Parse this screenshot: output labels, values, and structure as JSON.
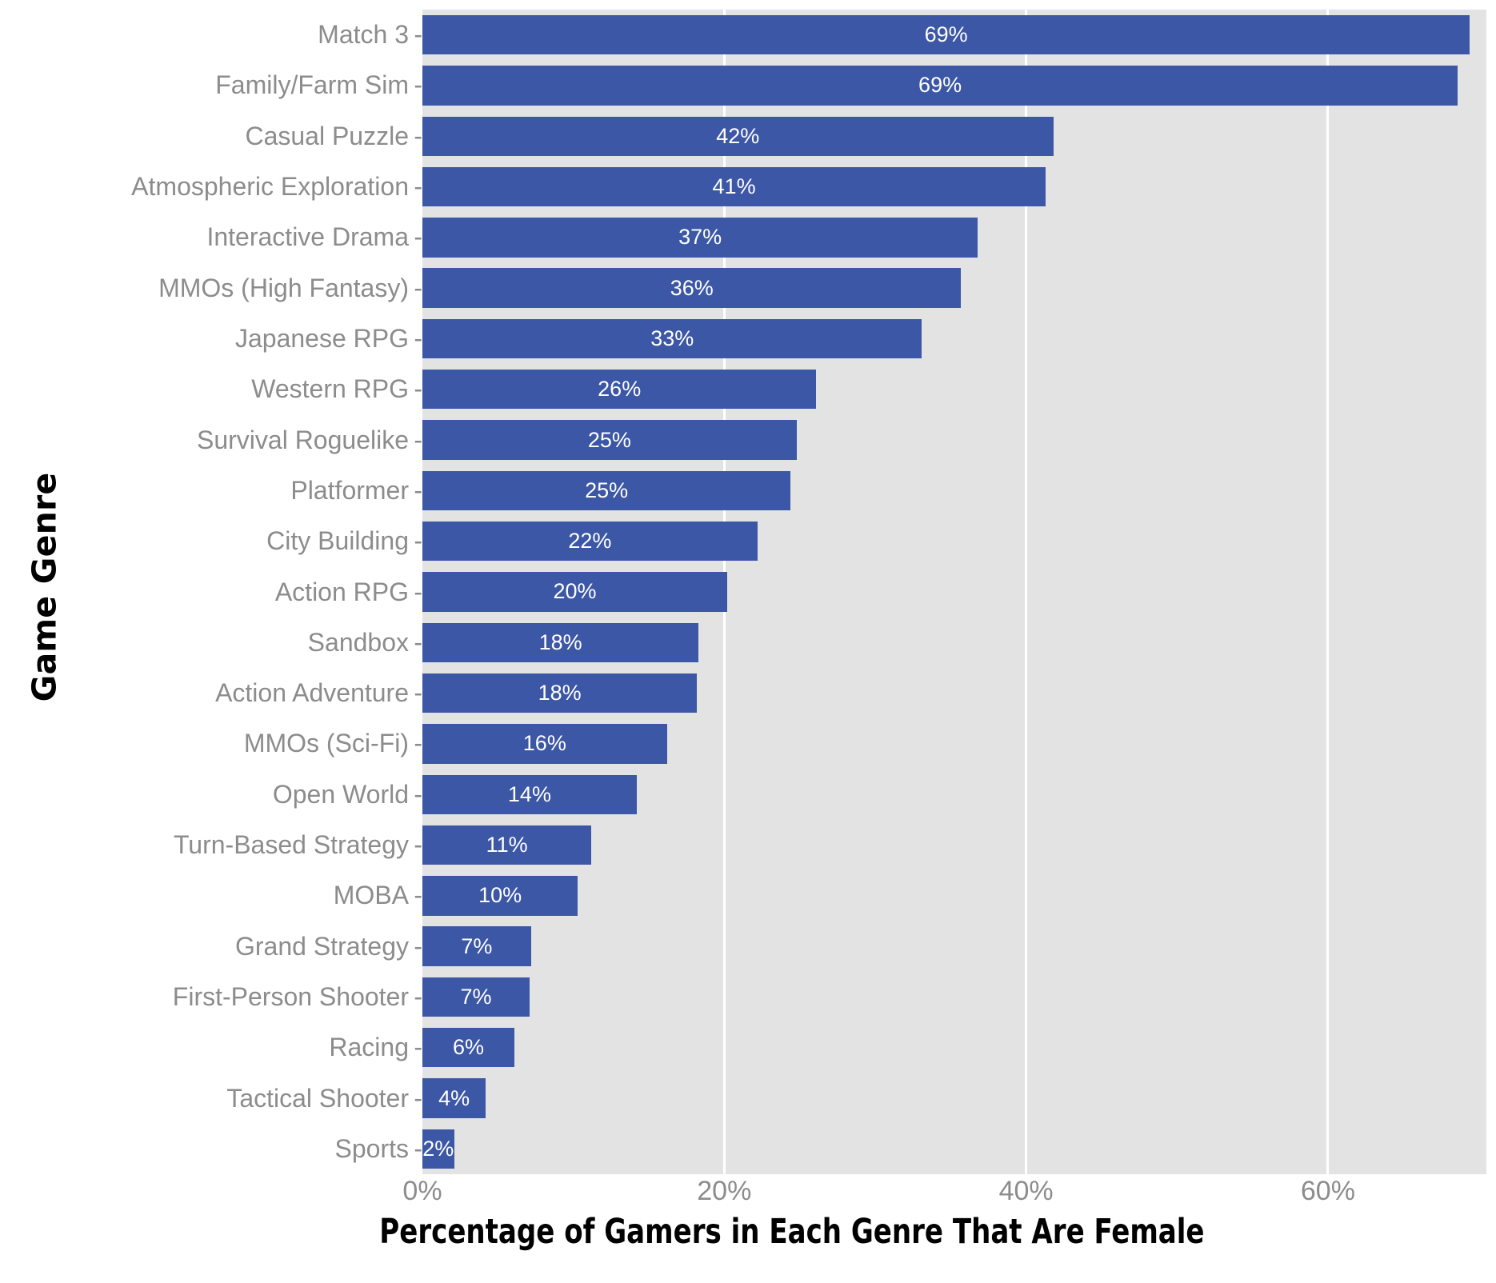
{
  "chart_data": {
    "type": "bar",
    "orientation": "horizontal",
    "title": "",
    "xlabel": "Percentage of Gamers in Each Genre That Are Female",
    "ylabel": "Game Genre",
    "xlim": [
      0,
      70.5
    ],
    "xticks": [
      0,
      20,
      40,
      60
    ],
    "xtick_labels": [
      "0%",
      "20%",
      "40%",
      "60%"
    ],
    "grid": "vertical-major-only",
    "legend": "none",
    "bar_color": "#3c57a6",
    "panel_color": "#e3e3e3",
    "gridline_color": "#ffffff",
    "tick_label_color": "#8c8c8c",
    "axis_title_color": "#000000",
    "value_label_color": "#ffffff",
    "value_label_suffix": "%",
    "categories": [
      "Match 3",
      "Family/Farm Sim",
      "Casual Puzzle",
      "Atmospheric Exploration",
      "Interactive Drama",
      "MMOs (High Fantasy)",
      "Japanese RPG",
      "Western RPG",
      "Survival Roguelike",
      "Platformer",
      "City Building",
      "Action RPG",
      "Sandbox",
      "Action Adventure",
      "MMOs (Sci-Fi)",
      "Open World",
      "Turn-Based Strategy",
      "MOBA",
      "Grand Strategy",
      "First-Person Shooter",
      "Racing",
      "Tactical Shooter",
      "Sports"
    ],
    "values": [
      69.4,
      68.6,
      41.8,
      41.3,
      36.8,
      35.7,
      33.1,
      26.1,
      24.8,
      24.4,
      22.2,
      20.2,
      18.3,
      18.2,
      16.2,
      14.2,
      11.2,
      10.3,
      7.2,
      7.1,
      6.1,
      4.2,
      2.1
    ],
    "value_labels": [
      "69%",
      "69%",
      "42%",
      "41%",
      "37%",
      "36%",
      "33%",
      "26%",
      "25%",
      "25%",
      "22%",
      "20%",
      "18%",
      "18%",
      "16%",
      "14%",
      "11%",
      "10%",
      "7%",
      "7%",
      "6%",
      "4%",
      "2%"
    ]
  }
}
